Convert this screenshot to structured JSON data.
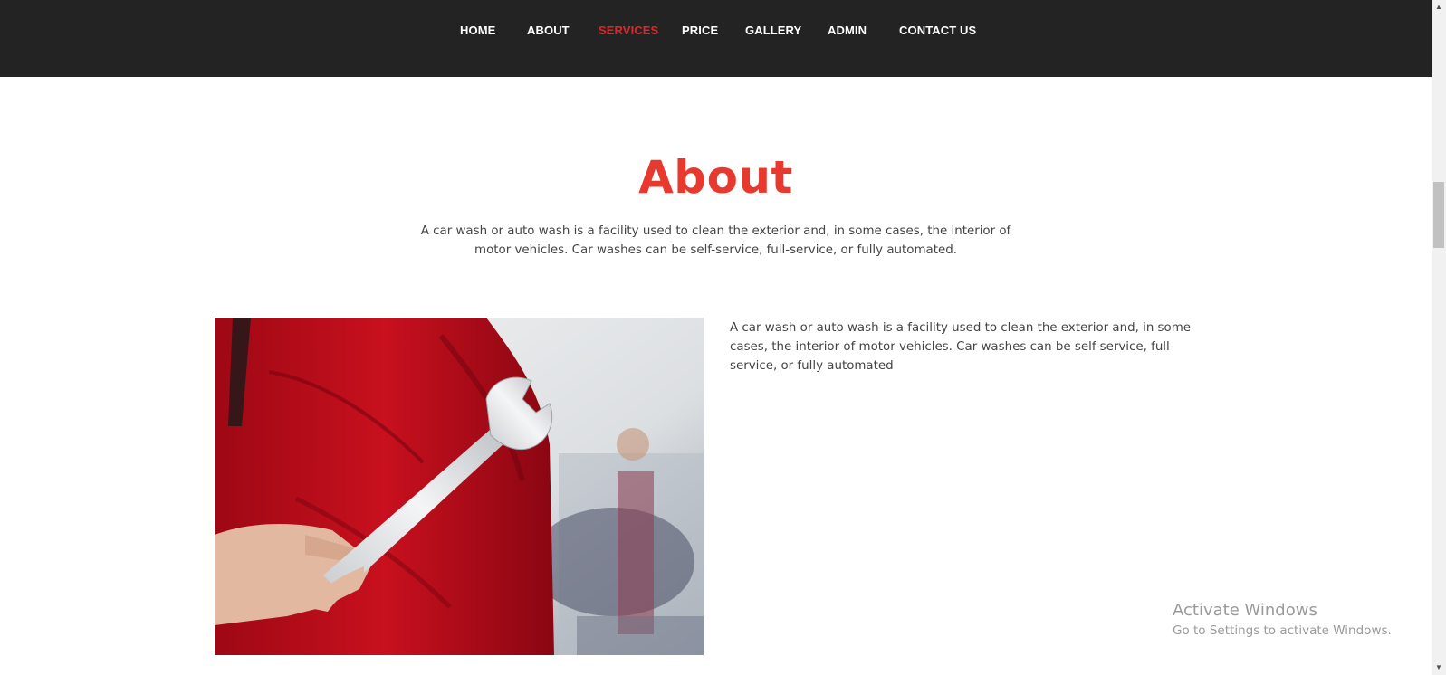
{
  "nav": {
    "items": [
      {
        "label": "HOME",
        "active": false
      },
      {
        "label": "ABOUT",
        "active": false
      },
      {
        "label": "SERVICES",
        "active": true
      },
      {
        "label": "PRICE",
        "active": false
      },
      {
        "label": "GALLERY",
        "active": false
      },
      {
        "label": "ADMIN",
        "active": false
      },
      {
        "label": "CONTACT US",
        "active": false
      }
    ],
    "active_color": "#e0262b",
    "background": "#232323"
  },
  "about": {
    "title": "About",
    "intro": "A car wash or auto wash is a facility used to clean the exterior and, in some cases, the interior of motor vehicles. Car washes can be self-service, full-service, or fully automated.",
    "body": "A car wash or auto wash is a facility used to clean the exterior and, in some cases, the interior of motor vehicles. Car washes can be self-service, full-service, or fully automated",
    "title_color": "#e8392f"
  },
  "photo": {
    "icon": "mechanic-with-wrench-photo"
  },
  "watermark": {
    "title": "Activate Windows",
    "subtitle": "Go to Settings to activate Windows."
  }
}
